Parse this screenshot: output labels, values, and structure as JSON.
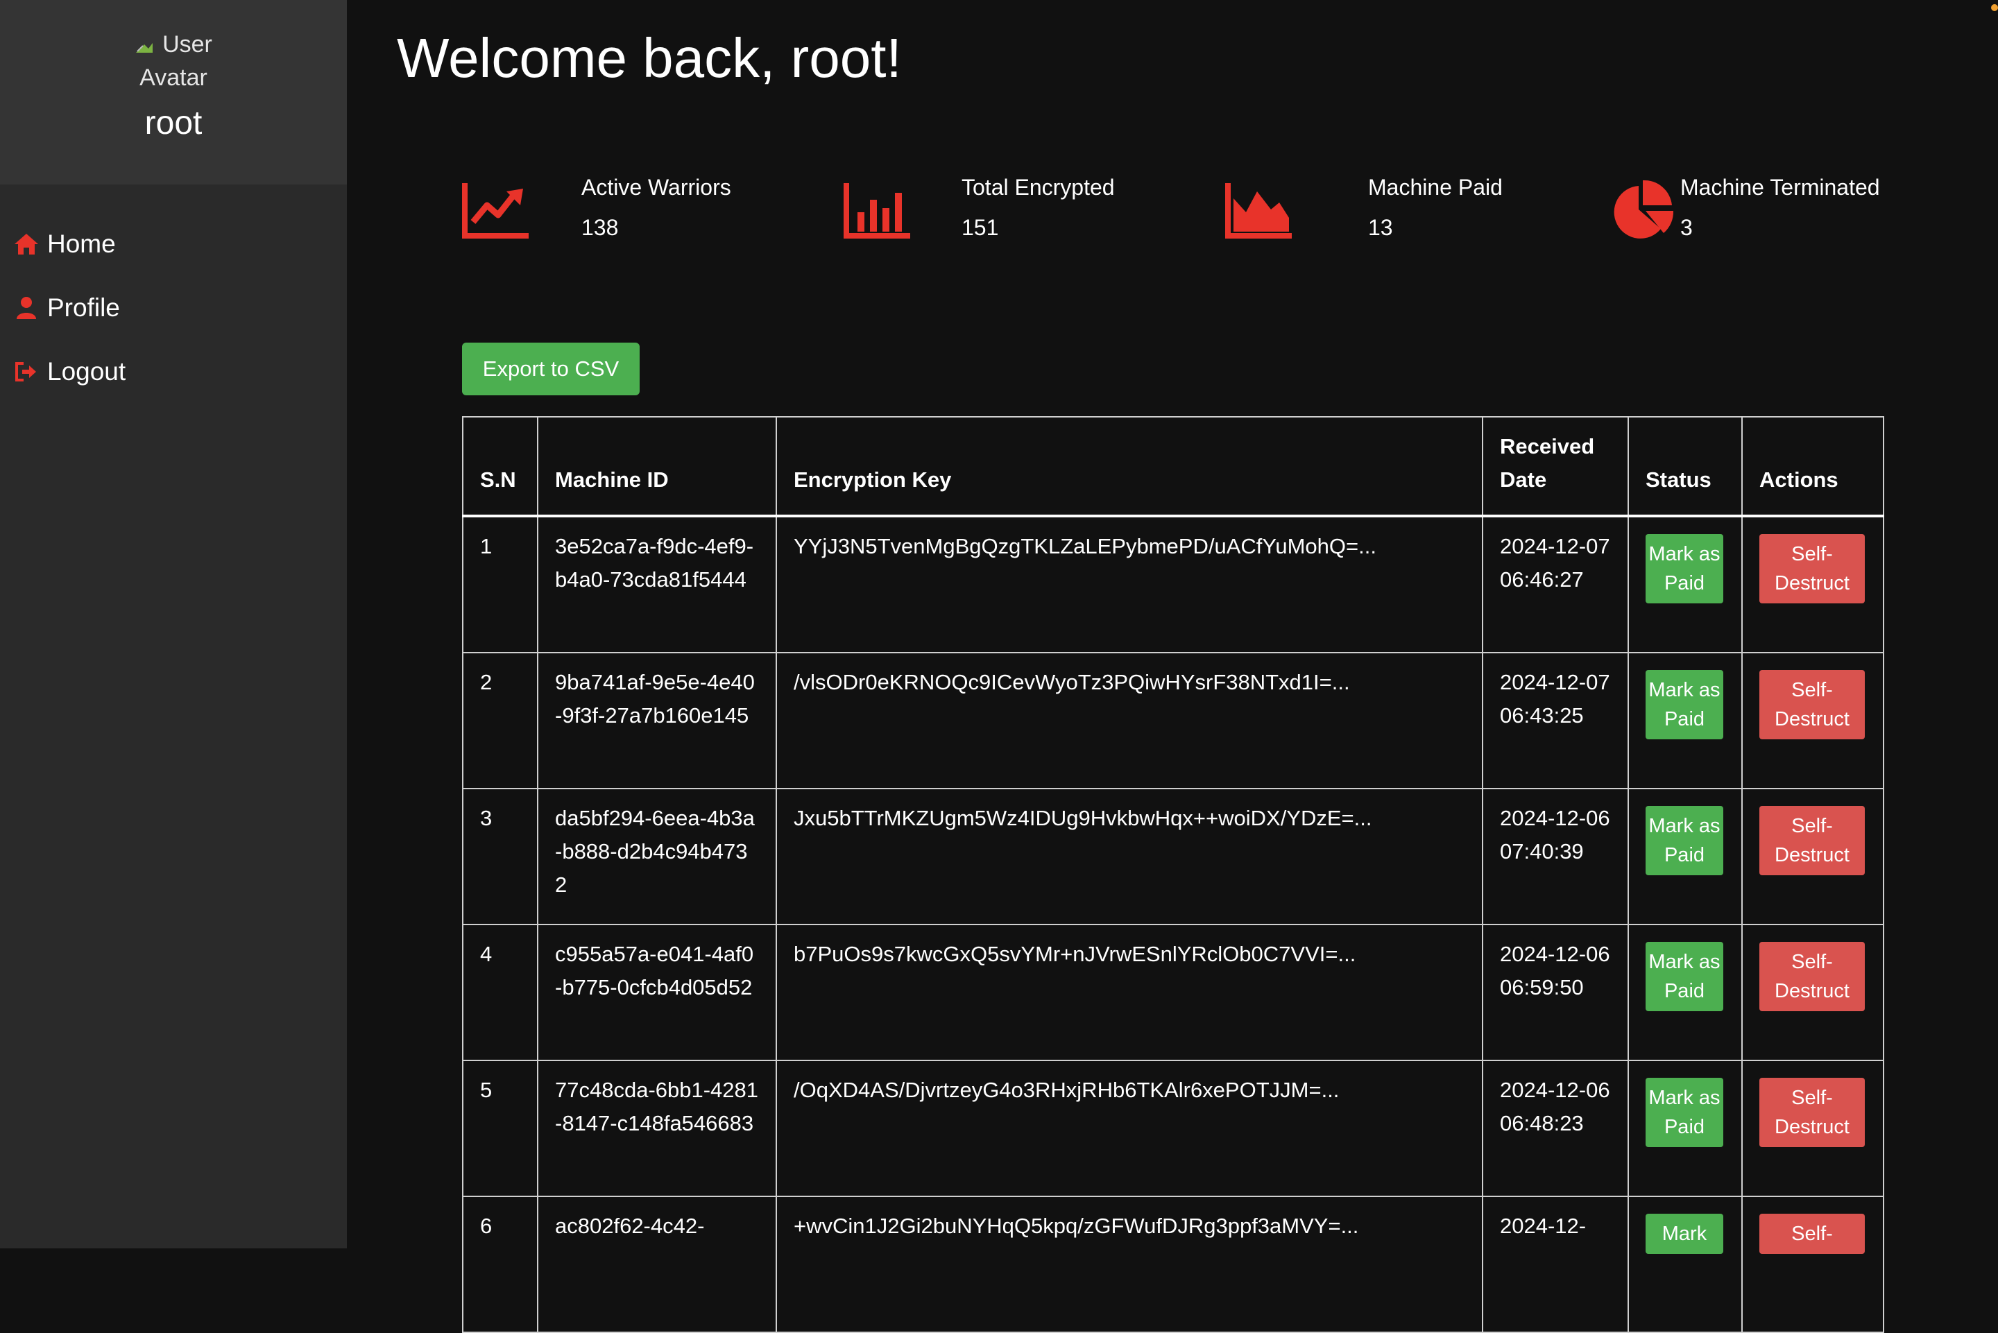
{
  "sidebar": {
    "avatar_alt": "User Avatar",
    "username": "root",
    "nav": [
      {
        "label": "Home",
        "icon": "home-icon"
      },
      {
        "label": "Profile",
        "icon": "user-icon"
      },
      {
        "label": "Logout",
        "icon": "sign-out-icon"
      }
    ]
  },
  "main": {
    "title": "Welcome back, root!",
    "stats": [
      {
        "label": "Active Warriors",
        "value": "138",
        "icon": "line-chart-icon"
      },
      {
        "label": "Total Encrypted",
        "value": "151",
        "icon": "bar-chart-icon"
      },
      {
        "label": "Machine Paid",
        "value": "13",
        "icon": "area-chart-icon"
      },
      {
        "label": "Machine Terminated",
        "value": "3",
        "icon": "pie-chart-icon"
      }
    ],
    "export_label": "Export to CSV",
    "table": {
      "headers": [
        "S.N",
        "Machine ID",
        "Encryption Key",
        "Received Date",
        "Status",
        "Actions"
      ],
      "rows": [
        {
          "sn": "1",
          "machine_id": "3e52ca7a-f9dc-4ef9-b4a0-73cda81f5444",
          "key": "YYjJ3N5TvenMgBgQzgTKLZaLEPybmePD/uACfYuMohQ=...",
          "date": "2024-12-07 06:46:27",
          "status": "Mark as Paid",
          "action": "Self-Destruct"
        },
        {
          "sn": "2",
          "machine_id": "9ba741af-9e5e-4e40-9f3f-27a7b160e145",
          "key": "/vlsODr0eKRNOQc9ICevWyoTz3PQiwHYsrF38NTxd1I=...",
          "date": "2024-12-07 06:43:25",
          "status": "Mark as Paid",
          "action": "Self-Destruct"
        },
        {
          "sn": "3",
          "machine_id": "da5bf294-6eea-4b3a-b888-d2b4c94b4732",
          "key": "Jxu5bTTrMKZUgm5Wz4IDUg9HvkbwHqx++woiDX/YDzE=...",
          "date": "2024-12-06 07:40:39",
          "status": "Mark as Paid",
          "action": "Self-Destruct"
        },
        {
          "sn": "4",
          "machine_id": "c955a57a-e041-4af0-b775-0cfcb4d05d52",
          "key": "b7PuOs9s7kwcGxQ5svYMr+nJVrwESnlYRclOb0C7VVI=...",
          "date": "2024-12-06 06:59:50",
          "status": "Mark as Paid",
          "action": "Self-Destruct"
        },
        {
          "sn": "5",
          "machine_id": "77c48cda-6bb1-4281-8147-c148fa546683",
          "key": "/OqXD4AS/DjvrtzeyG4o3RHxjRHb6TKAlr6xePOTJJM=...",
          "date": "2024-12-06 06:48:23",
          "status": "Mark as Paid",
          "action": "Self-Destruct"
        },
        {
          "sn": "6",
          "machine_id": "ac802f62-4c42-",
          "key": "+wvCin1J2Gi2buNYHqQ5kpq/zGFWufDJRg3ppf3aMVY=...",
          "date": "2024-12-",
          "status": "Mark",
          "action": "Self-"
        }
      ]
    }
  },
  "colors": {
    "accent": "#e8332a",
    "success": "#4caf50",
    "danger": "#d9534f",
    "sidebar": "#2a2a2a",
    "background": "#111111"
  }
}
